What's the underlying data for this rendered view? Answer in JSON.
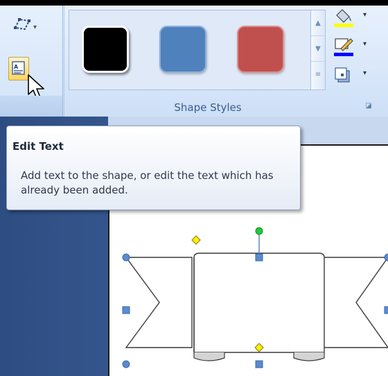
{
  "ribbon": {
    "group_caption": "Shape Styles",
    "dialog_launcher_icon": "dialog-launcher-icon",
    "left_tools": [
      "edit-shape-icon",
      "edit-text-icon"
    ],
    "style_swatches": [
      {
        "name": "black",
        "color": "#000000"
      },
      {
        "name": "blue",
        "color": "#4f81bd"
      },
      {
        "name": "red",
        "color": "#c0504d"
      }
    ],
    "side_tools": [
      "shape-fill-icon",
      "shape-outline-icon",
      "shape-effects-icon"
    ],
    "fill_color": "#ffff00",
    "outline_color": "#0000ff"
  },
  "tooltip": {
    "title": "Edit Text",
    "body": "Add text to the shape, or edit the text which has already been added."
  }
}
